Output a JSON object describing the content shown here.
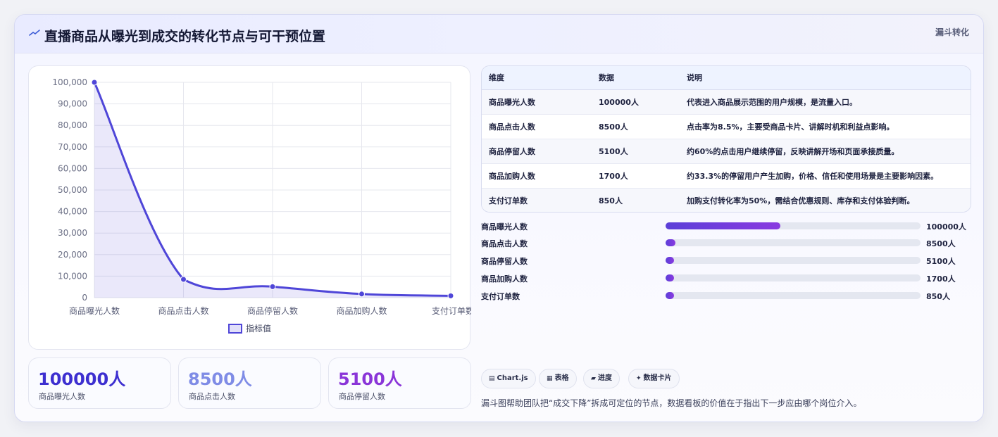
{
  "header": {
    "icon": "trend-line-icon",
    "title": "直播商品从曝光到成交的转化节点与可干预位置",
    "tag": "漏斗转化"
  },
  "chart_data": {
    "type": "line",
    "categories": [
      "商品曝光人数",
      "商品点击人数",
      "商品停留人数",
      "商品加购人数",
      "支付订单数"
    ],
    "series": [
      {
        "name": "指标值",
        "values": [
          100000,
          8500,
          5100,
          1700,
          850
        ]
      }
    ],
    "ylim": [
      0,
      100000
    ],
    "yticks": [
      "100,000",
      "90,000",
      "80,000",
      "70,000",
      "60,000",
      "50,000",
      "40,000",
      "30,000",
      "20,000",
      "10,000",
      "0"
    ],
    "grid": true,
    "fill": true,
    "legend": "bottom",
    "color": "#4f46d8"
  },
  "kpis": [
    {
      "value": "100000人",
      "label": "商品曝光人数",
      "color": "#3d2fd0"
    },
    {
      "value": "8500人",
      "label": "商品点击人数",
      "color": "#7f8ce6"
    },
    {
      "value": "5100人",
      "label": "商品停留人数",
      "color": "#8a35d8"
    }
  ],
  "table": {
    "headers": [
      "维度",
      "数据",
      "说明"
    ],
    "rows": [
      [
        "商品曝光人数",
        "100000人",
        "代表进入商品展示范围的用户规模，是流量入口。"
      ],
      [
        "商品点击人数",
        "8500人",
        "点击率为8.5%，主要受商品卡片、讲解时机和利益点影响。"
      ],
      [
        "商品停留人数",
        "5100人",
        "约60%的点击用户继续停留，反映讲解开场和页面承接质量。"
      ],
      [
        "商品加购人数",
        "1700人",
        "约33.3%的停留用户产生加购，价格、信任和使用场景是主要影响因素。"
      ],
      [
        "支付订单数",
        "850人",
        "加购支付转化率为50%，需结合优惠规则、库存和支付体验判断。"
      ]
    ]
  },
  "progress": [
    {
      "label": "商品曝光人数",
      "value": "100000人",
      "fraction": 0.45
    },
    {
      "label": "商品点击人数",
      "value": "8500人",
      "fraction": 0.038
    },
    {
      "label": "商品停留人数",
      "value": "5100人",
      "fraction": 0.023
    },
    {
      "label": "商品加购人数",
      "value": "1700人",
      "fraction": 0.008
    },
    {
      "label": "支付订单数",
      "value": "850人",
      "fraction": 0.004
    }
  ],
  "chips": [
    {
      "icon": "▤",
      "label": "Chart.js"
    },
    {
      "icon": "▦",
      "label": "表格"
    },
    {
      "icon": "▰",
      "label": "进度"
    },
    {
      "icon": "✦",
      "label": "数据卡片"
    }
  ],
  "note": "漏斗图帮助团队把“成交下降”拆成可定位的节点，数据看板的价值在于指出下一步应由哪个岗位介入。"
}
